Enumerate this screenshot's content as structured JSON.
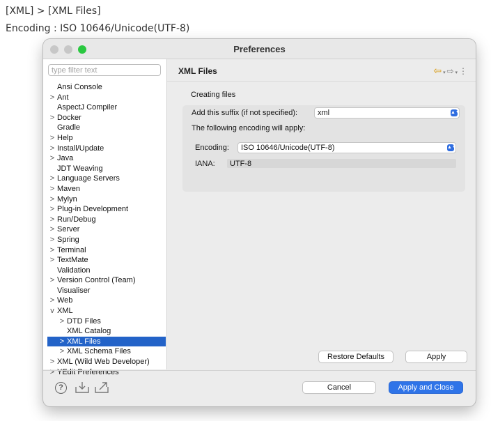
{
  "caption": {
    "line1": "[XML] > [XML Files]",
    "line2": "Encoding : ISO 10646/Unicode(UTF-8)"
  },
  "window": {
    "title": "Preferences"
  },
  "filter": {
    "placeholder": "type filter text"
  },
  "tree": [
    {
      "label": "Ansi Console",
      "chevron": ""
    },
    {
      "label": "Ant",
      "chevron": ">"
    },
    {
      "label": "AspectJ Compiler",
      "chevron": ""
    },
    {
      "label": "Docker",
      "chevron": ">"
    },
    {
      "label": "Gradle",
      "chevron": ""
    },
    {
      "label": "Help",
      "chevron": ">"
    },
    {
      "label": "Install/Update",
      "chevron": ">"
    },
    {
      "label": "Java",
      "chevron": ">"
    },
    {
      "label": "JDT Weaving",
      "chevron": ""
    },
    {
      "label": "Language Servers",
      "chevron": ">"
    },
    {
      "label": "Maven",
      "chevron": ">"
    },
    {
      "label": "Mylyn",
      "chevron": ">"
    },
    {
      "label": "Plug-in Development",
      "chevron": ">"
    },
    {
      "label": "Run/Debug",
      "chevron": ">"
    },
    {
      "label": "Server",
      "chevron": ">"
    },
    {
      "label": "Spring",
      "chevron": ">"
    },
    {
      "label": "Terminal",
      "chevron": ">"
    },
    {
      "label": "TextMate",
      "chevron": ">"
    },
    {
      "label": "Validation",
      "chevron": ""
    },
    {
      "label": "Version Control (Team)",
      "chevron": ">"
    },
    {
      "label": "Visualiser",
      "chevron": ""
    },
    {
      "label": "Web",
      "chevron": ">"
    },
    {
      "label": "XML",
      "chevron": "v"
    },
    {
      "label": "DTD Files",
      "chevron": ">"
    },
    {
      "label": "XML Catalog",
      "chevron": ""
    },
    {
      "label": "XML Files",
      "chevron": ">"
    },
    {
      "label": "XML Schema Files",
      "chevron": ">"
    },
    {
      "label": "XML (Wild Web Developer)",
      "chevron": ">"
    },
    {
      "label": "YEdit Preferences",
      "chevron": ">"
    }
  ],
  "page": {
    "title": "XML Files",
    "section_label": "Creating files",
    "suffix_label": "Add this suffix (if not specified):",
    "suffix_value": "xml",
    "encoding_note": "The following encoding will apply:",
    "encoding_label": "Encoding:",
    "encoding_value": "ISO 10646/Unicode(UTF-8)",
    "iana_label": "IANA:",
    "iana_value": "UTF-8"
  },
  "buttons": {
    "restore_defaults": "Restore Defaults",
    "apply": "Apply",
    "cancel": "Cancel",
    "apply_and_close": "Apply and Close"
  },
  "icons": {
    "help": "?",
    "nav_back": "⇦",
    "nav_forward": "⇨",
    "menu": "⋮"
  },
  "colors": {
    "selection": "#2363c8",
    "primary_button": "#2f74e8",
    "select_arrow": "#2f6de0"
  }
}
